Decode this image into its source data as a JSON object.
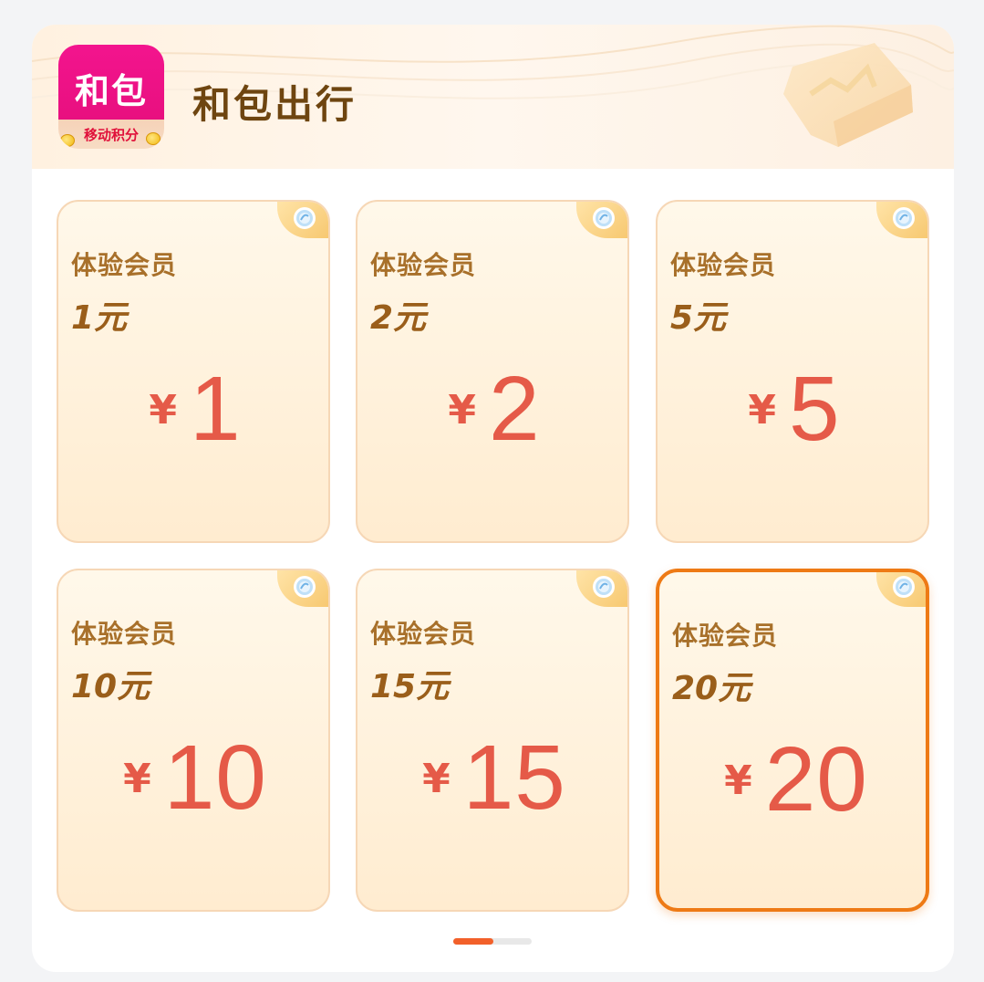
{
  "header": {
    "logo_text": "和包",
    "logo_subtext": "移动积分",
    "title": "和包出行"
  },
  "cards": [
    {
      "label": "体验会员",
      "amount": "1元",
      "currency": "¥",
      "price": "1",
      "selected": false
    },
    {
      "label": "体验会员",
      "amount": "2元",
      "currency": "¥",
      "price": "2",
      "selected": false
    },
    {
      "label": "体验会员",
      "amount": "5元",
      "currency": "¥",
      "price": "5",
      "selected": false
    },
    {
      "label": "体验会员",
      "amount": "10元",
      "currency": "¥",
      "price": "10",
      "selected": false
    },
    {
      "label": "体验会员",
      "amount": "15元",
      "currency": "¥",
      "price": "15",
      "selected": false
    },
    {
      "label": "体验会员",
      "amount": "20元",
      "currency": "¥",
      "price": "20",
      "selected": true
    }
  ],
  "pager": {
    "current_page": 1,
    "total_pages": 2
  },
  "colors": {
    "accent": "#ee7a15",
    "price": "#e55a48",
    "brand_pink": "#e8107f",
    "title": "#6e4510"
  }
}
